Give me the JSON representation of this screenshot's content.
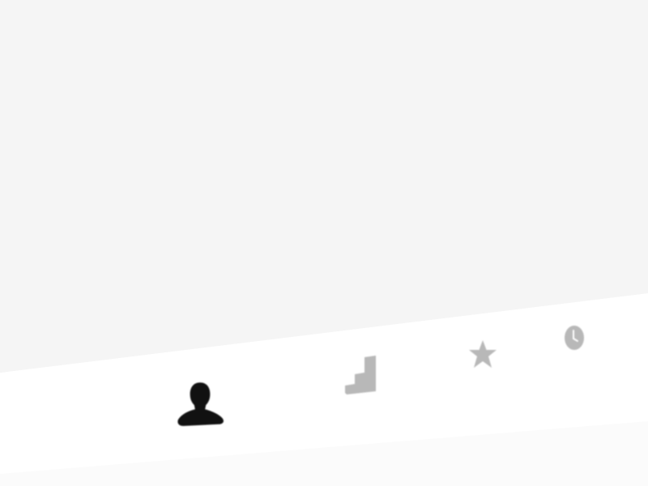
{
  "app": {
    "content_color": "#f5f5f5",
    "tabbar_color": "#ffffff"
  },
  "tabbar": {
    "active_color": "#111111",
    "inactive_color": "#b8b8b8",
    "tabs": [
      {
        "id": "profile",
        "icon": "person-icon",
        "active": true
      },
      {
        "id": "progress",
        "icon": "stairs-icon",
        "active": false
      },
      {
        "id": "favorites",
        "icon": "star-icon",
        "active": false
      },
      {
        "id": "history",
        "icon": "clock-icon",
        "active": false
      }
    ]
  }
}
